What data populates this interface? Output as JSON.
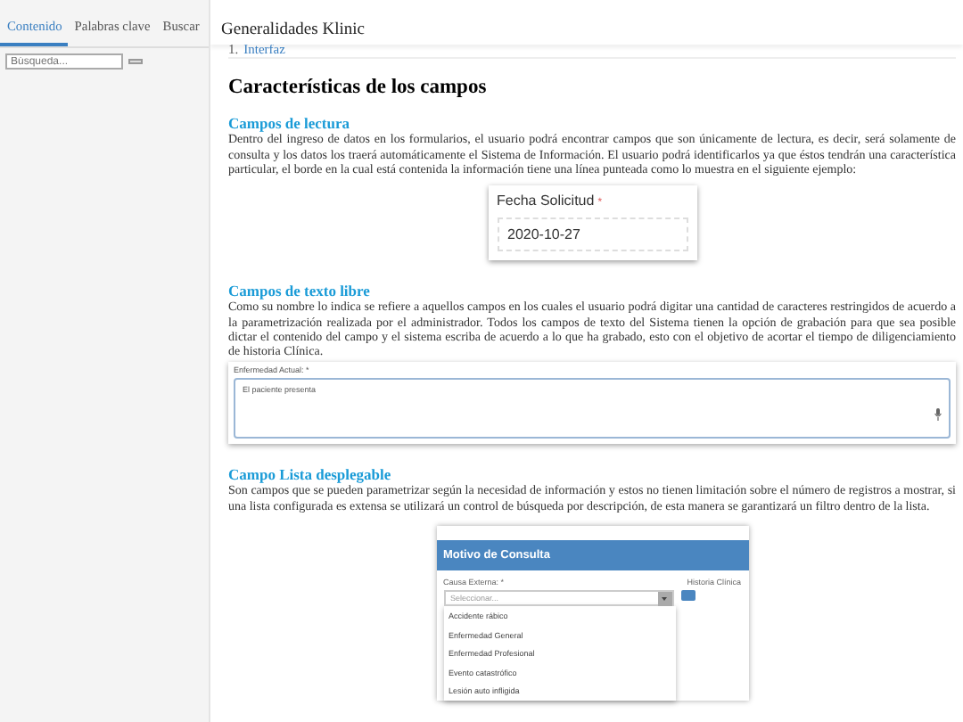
{
  "sidebar": {
    "tabs": [
      {
        "label": "Contenido",
        "selected": true
      },
      {
        "label": "Palabras clave",
        "selected": false
      },
      {
        "label": "Buscar",
        "selected": false
      }
    ],
    "search": {
      "placeholder": "Búsqueda..."
    }
  },
  "header": {
    "title": "Generalidades Klinic"
  },
  "breadcrumb": {
    "number": "1.",
    "label": "Interfaz"
  },
  "article": {
    "title": "Características de los campos",
    "sections": [
      {
        "heading": "Campos de lectura",
        "paragraph": "Dentro del ingreso de datos en los formularios, el usuario podrá encontrar campos que son únicamente de lectura, es decir, será solamente de consulta y los datos los traerá automáticamente el Sistema de Información. El usuario podrá identificarlos ya que éstos tendrán una característica particular, el borde en la cual está contenida la información tiene una línea punteada como lo muestra en el siguiente ejemplo:",
        "figure": {
          "kind": "readonly_field",
          "label": "Fecha Solicitud",
          "required": "*",
          "value": "2020-10-27"
        }
      },
      {
        "heading": "Campos de texto libre",
        "paragraph": "Como su nombre lo indica se refiere a aquellos campos en los cuales el usuario podrá digitar una cantidad de caracteres restringidos de acuerdo a la parametrización realizada por el administrador.  Todos los campos de texto del Sistema tienen la opción de grabación para que sea posible dictar el contenido del campo y el sistema escriba de acuerdo a lo que ha grabado, esto con el objetivo de acortar el tiempo de diligenciamiento de historia Clínica.",
        "figure": {
          "kind": "text_area",
          "label": "Enfermedad Actual: *",
          "value": "El paciente presenta"
        }
      },
      {
        "heading": "Campo Lista desplegable",
        "paragraph": "Son campos que se pueden parametrizar según la necesidad de información y estos no tienen limitación sobre el número de registros a mostrar, si una lista configurada es extensa se utilizará un control de búsqueda por descripción, de esta manera se garantizará un filtro dentro de la lista.",
        "figure": {
          "kind": "dropdown_form",
          "panel_title": "Motivo de Consulta",
          "field_label": "Causa Externa: *",
          "placeholder": "Seleccionar...",
          "side_label": "Historia Clínica",
          "toggle_on": true,
          "options": [
            "Accidente rábico",
            "Enfermedad General",
            "Enfermedad Profesional",
            "Evento catastrófico",
            "Lesión auto infligida"
          ]
        }
      }
    ]
  }
}
